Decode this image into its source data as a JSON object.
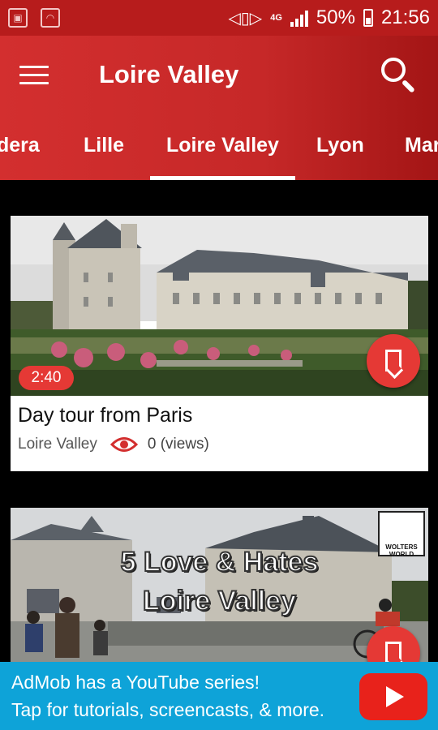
{
  "status_bar": {
    "battery_percent": "50%",
    "time": "21:56",
    "network": "4G"
  },
  "app_bar": {
    "title": "Loire Valley"
  },
  "tabs": [
    {
      "label": "dera",
      "active": false
    },
    {
      "label": "Lille",
      "active": false
    },
    {
      "label": "Loire Valley",
      "active": true
    },
    {
      "label": "Lyon",
      "active": false
    },
    {
      "label": "Mar",
      "active": false
    }
  ],
  "videos": [
    {
      "duration": "2:40",
      "title": "Day tour from Paris",
      "channel": "Loire Valley",
      "views": "0 (views)"
    },
    {
      "thumbnail_text_line1": "5 Love & Hates",
      "thumbnail_text_line2": "Loire Valley",
      "logo_text": "WOLTERS WORLD"
    }
  ],
  "ad": {
    "line1": "AdMob has a YouTube series!",
    "line2": "Tap for tutorials, screencasts, & more."
  },
  "colors": {
    "primary": "#c62828",
    "status_bar": "#b71c1c",
    "accent": "#e53935",
    "ad_background": "#0ea3d8"
  }
}
